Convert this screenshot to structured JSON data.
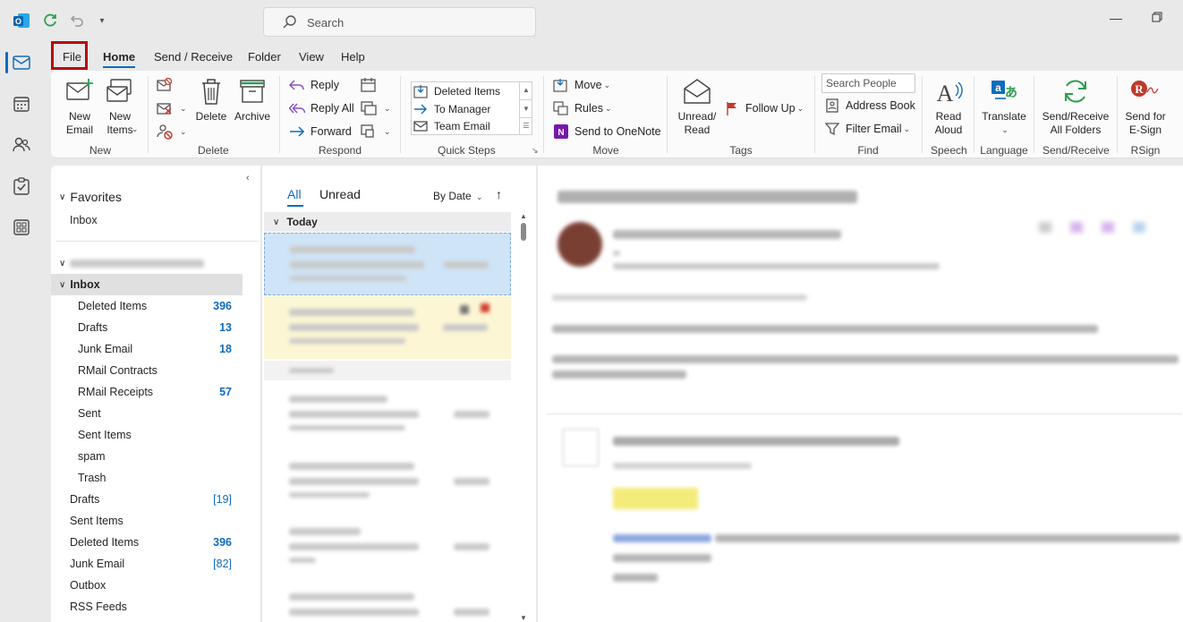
{
  "titlebar": {
    "search_placeholder": "Search"
  },
  "tabs": [
    "File",
    "Home",
    "Send / Receive",
    "Folder",
    "View",
    "Help"
  ],
  "ribbon": {
    "new": {
      "group": "New",
      "new_email": "New\nEmail",
      "new_items": "New\nItems"
    },
    "delete": {
      "group": "Delete",
      "delete": "Delete",
      "archive": "Archive"
    },
    "respond": {
      "group": "Respond",
      "reply": "Reply",
      "reply_all": "Reply All",
      "forward": "Forward"
    },
    "quick_steps": {
      "group": "Quick Steps",
      "items": [
        "Deleted Items",
        "To Manager",
        "Team Email"
      ]
    },
    "move": {
      "group": "Move",
      "move": "Move",
      "rules": "Rules",
      "onenote": "Send to OneNote"
    },
    "tags": {
      "group": "Tags",
      "unread_read": "Unread/\nRead",
      "follow_up": "Follow Up"
    },
    "find": {
      "group": "Find",
      "search_people": "Search People",
      "address_book": "Address Book",
      "filter_email": "Filter Email"
    },
    "speech": {
      "group": "Speech",
      "read_aloud": "Read\nAloud"
    },
    "language": {
      "group": "Language",
      "translate": "Translate"
    },
    "send_receive": {
      "group": "Send/Receive",
      "send_receive_all": "Send/Receive\nAll Folders"
    },
    "rsign": {
      "group": "RSign",
      "send_for_esign": "Send for\nE-Sign"
    }
  },
  "folders": {
    "favorites_label": "Favorites",
    "favorites": [
      {
        "name": "Inbox"
      }
    ],
    "inbox_label": "Inbox",
    "inbox_children": [
      {
        "name": "Deleted Items",
        "count": "396"
      },
      {
        "name": "Drafts",
        "count": "13"
      },
      {
        "name": "Junk Email",
        "count": "18"
      },
      {
        "name": "RMail Contracts",
        "count": ""
      },
      {
        "name": "RMail Receipts",
        "count": "57"
      },
      {
        "name": "Sent",
        "count": ""
      },
      {
        "name": "Sent Items",
        "count": ""
      },
      {
        "name": "spam",
        "count": ""
      },
      {
        "name": "Trash",
        "count": ""
      }
    ],
    "root": [
      {
        "name": "Drafts",
        "count": "[19]"
      },
      {
        "name": "Sent Items",
        "count": ""
      },
      {
        "name": "Deleted Items",
        "count": "396"
      },
      {
        "name": "Junk Email",
        "count": "[82]"
      },
      {
        "name": "Outbox",
        "count": ""
      },
      {
        "name": "RSS Feeds",
        "count": ""
      }
    ]
  },
  "message_list": {
    "tab_all": "All",
    "tab_unread": "Unread",
    "sort": "By Date",
    "group_today": "Today"
  },
  "colors": {
    "accent": "#0f6cbd",
    "selected_msg": "#cfe4f7",
    "flagged_msg": "#fdf6d4",
    "highlight_box": "#c00000"
  }
}
